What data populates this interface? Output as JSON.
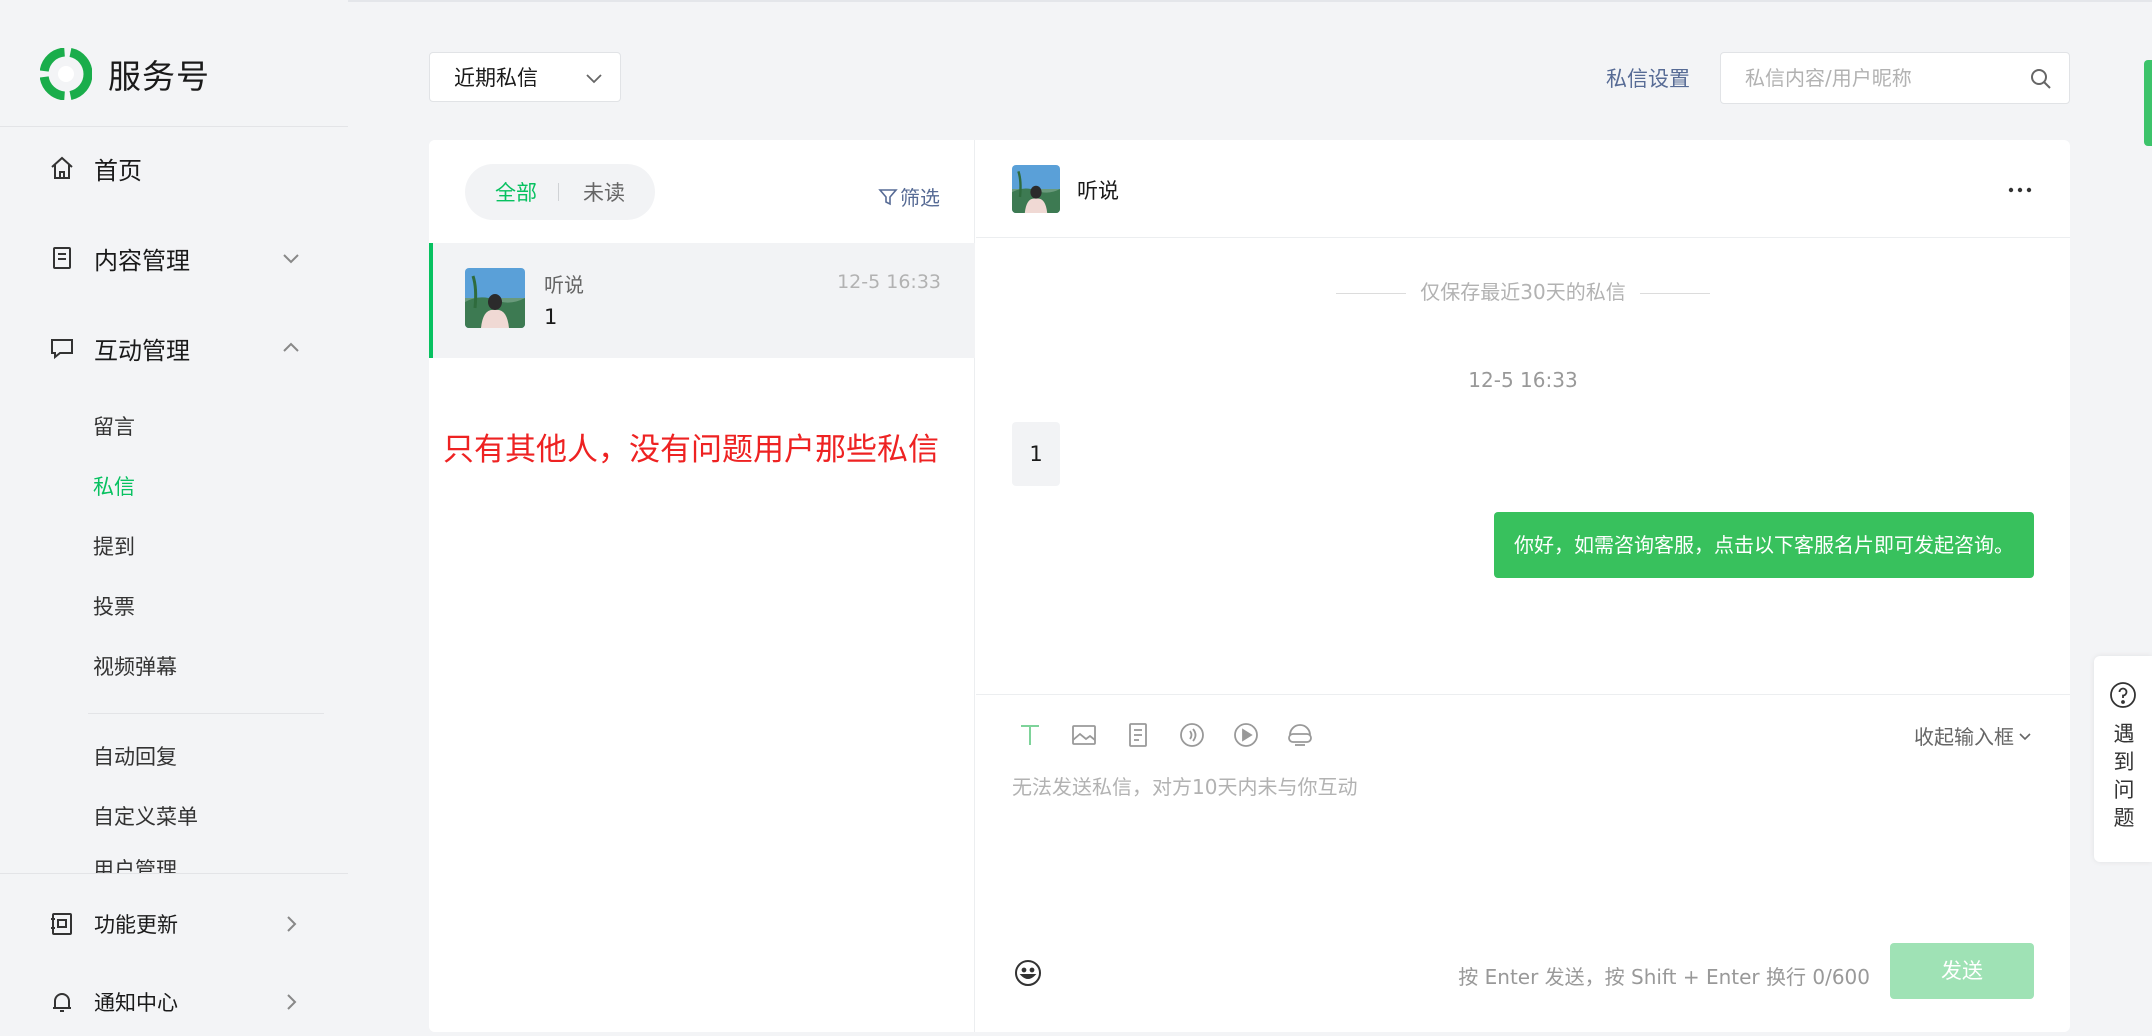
{
  "brand": {
    "title": "服务号"
  },
  "sidebar": {
    "home": {
      "label": "首页"
    },
    "content": {
      "label": "内容管理"
    },
    "interaction": {
      "label": "互动管理"
    },
    "sub_items": [
      "留言",
      "私信",
      "提到",
      "投票",
      "视频弹幕"
    ],
    "active_sub": "私信",
    "sub_items_2": [
      "自动回复",
      "自定义菜单",
      "用户管理"
    ],
    "updates": {
      "label": "功能更新"
    },
    "notifications": {
      "label": "通知中心"
    }
  },
  "topbar": {
    "select_value": "近期私信",
    "settings_label": "私信设置",
    "search_placeholder": "私信内容/用户昵称"
  },
  "list": {
    "tabs": [
      "全部",
      "未读"
    ],
    "active_tab": "全部",
    "filter_label": "筛选",
    "conversations": [
      {
        "name": "听说",
        "time": "12-5 16:33",
        "preview": "1"
      }
    ]
  },
  "annotation": "只有其他人，没有问题用户那些私信",
  "chat": {
    "contact_name": "听说",
    "notice": "仅保存最近30天的私信",
    "timestamp": "12-5 16:33",
    "incoming_message": "1",
    "outgoing_message": "你好，如需咨询客服，点击以下客服名片即可发起咨询。",
    "composer": {
      "collapse_label": "收起输入框",
      "placeholder": "无法发送私信，对方10天内未与你互动",
      "hint": "按 Enter 发送，按 Shift + Enter 换行  0/600",
      "send_label": "发送"
    }
  },
  "help": {
    "label": "遇到问题"
  },
  "colors": {
    "accent": "#07c160",
    "link": "#576b95",
    "outgoing_bubble": "#38c15d",
    "send_disabled": "#9fe2b5",
    "annotation": "#ee2222"
  }
}
